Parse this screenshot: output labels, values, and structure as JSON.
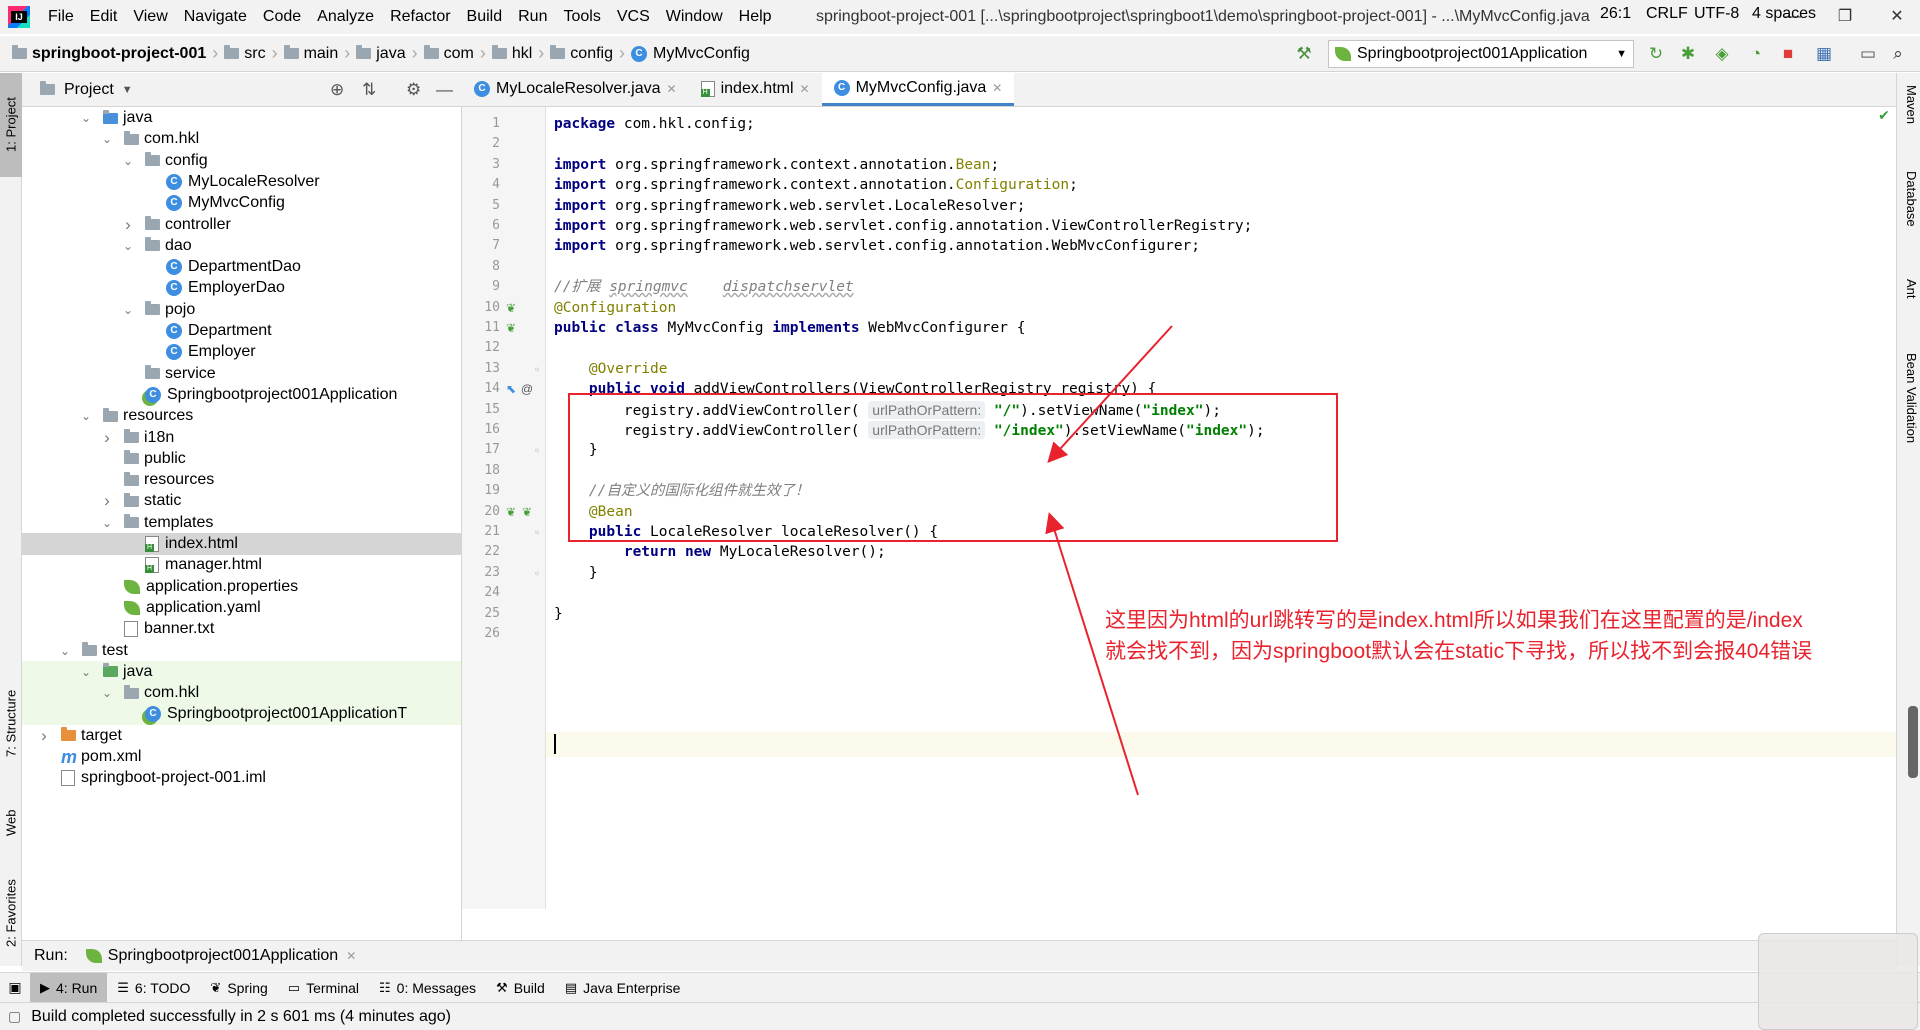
{
  "window": {
    "title": "springboot-project-001 [...\\springbootproject\\springboot1\\demo\\springboot-project-001] - ...\\MyMvcConfig.java",
    "minimize": "—",
    "restore": "❐",
    "close": "✕"
  },
  "menu": [
    "File",
    "Edit",
    "View",
    "Navigate",
    "Code",
    "Analyze",
    "Refactor",
    "Build",
    "Run",
    "Tools",
    "VCS",
    "Window",
    "Help"
  ],
  "breadcrumbs": [
    "springboot-project-001",
    "src",
    "main",
    "java",
    "com",
    "hkl",
    "config",
    "MyMvcConfig"
  ],
  "run_config": {
    "label": "Springbootproject001Application"
  },
  "icons": {
    "hammer": "hammer-icon",
    "rerun": "rerun-icon",
    "debug": "debug-icon",
    "coverage": "coverage-icon",
    "profile": "profile-icon",
    "stop": "stop-icon",
    "structure": "project-structure-icon",
    "layout": "layout-icon",
    "search": "search-icon"
  },
  "left_strip": {
    "project": "1: Project",
    "structure": "7: Structure",
    "web": "Web",
    "favorites": "2: Favorites"
  },
  "right_strip": {
    "maven": "Maven",
    "database": "Database",
    "ant": "Ant",
    "bean_validation": "Bean Validation"
  },
  "project_panel": {
    "title": "Project"
  },
  "tree": [
    {
      "label": "java",
      "depth": 3,
      "type": "folder-src",
      "arrow": "open"
    },
    {
      "label": "com.hkl",
      "depth": 4,
      "type": "package",
      "arrow": "open"
    },
    {
      "label": "config",
      "depth": 5,
      "type": "package",
      "arrow": "open"
    },
    {
      "label": "MyLocaleResolver",
      "depth": 6,
      "type": "class",
      "arrow": ""
    },
    {
      "label": "MyMvcConfig",
      "depth": 6,
      "type": "class",
      "arrow": ""
    },
    {
      "label": "controller",
      "depth": 5,
      "type": "package",
      "arrow": "closed"
    },
    {
      "label": "dao",
      "depth": 5,
      "type": "package",
      "arrow": "open"
    },
    {
      "label": "DepartmentDao",
      "depth": 6,
      "type": "class",
      "arrow": ""
    },
    {
      "label": "EmployerDao",
      "depth": 6,
      "type": "class",
      "arrow": ""
    },
    {
      "label": "pojo",
      "depth": 5,
      "type": "package",
      "arrow": "open"
    },
    {
      "label": "Department",
      "depth": 6,
      "type": "class",
      "arrow": ""
    },
    {
      "label": "Employer",
      "depth": 6,
      "type": "class",
      "arrow": ""
    },
    {
      "label": "service",
      "depth": 5,
      "type": "package",
      "arrow": ""
    },
    {
      "label": "Springbootproject001Application",
      "depth": 5,
      "type": "spring-class",
      "arrow": ""
    },
    {
      "label": "resources",
      "depth": 3,
      "type": "folder",
      "arrow": "open"
    },
    {
      "label": "i18n",
      "depth": 4,
      "type": "folder",
      "arrow": "closed"
    },
    {
      "label": "public",
      "depth": 4,
      "type": "folder",
      "arrow": ""
    },
    {
      "label": "resources",
      "depth": 4,
      "type": "folder",
      "arrow": ""
    },
    {
      "label": "static",
      "depth": 4,
      "type": "folder",
      "arrow": "closed"
    },
    {
      "label": "templates",
      "depth": 4,
      "type": "folder",
      "arrow": "open"
    },
    {
      "label": "index.html",
      "depth": 5,
      "type": "html",
      "arrow": "",
      "selected": true
    },
    {
      "label": "manager.html",
      "depth": 5,
      "type": "html",
      "arrow": ""
    },
    {
      "label": "application.properties",
      "depth": 4,
      "type": "properties",
      "arrow": ""
    },
    {
      "label": "application.yaml",
      "depth": 4,
      "type": "properties",
      "arrow": ""
    },
    {
      "label": "banner.txt",
      "depth": 4,
      "type": "text",
      "arrow": ""
    },
    {
      "label": "test",
      "depth": 2,
      "type": "folder",
      "arrow": "open"
    },
    {
      "label": "java",
      "depth": 3,
      "type": "folder-test",
      "arrow": "open",
      "test": true
    },
    {
      "label": "com.hkl",
      "depth": 4,
      "type": "package",
      "arrow": "open",
      "test": true
    },
    {
      "label": "Springbootproject001ApplicationT",
      "depth": 5,
      "type": "spring-class",
      "arrow": "",
      "test": true
    },
    {
      "label": "target",
      "depth": 1,
      "type": "folder-orange",
      "arrow": "closed"
    },
    {
      "label": "pom.xml",
      "depth": 1,
      "type": "maven",
      "arrow": ""
    },
    {
      "label": "springboot-project-001.iml",
      "depth": 1,
      "type": "text",
      "arrow": ""
    }
  ],
  "editor_tabs": [
    {
      "label": "MyLocaleResolver.java",
      "icon": "class",
      "active": false
    },
    {
      "label": "index.html",
      "icon": "html",
      "active": false
    },
    {
      "label": "MyMvcConfig.java",
      "icon": "class",
      "active": true
    }
  ],
  "code_lines": [
    [
      {
        "t": "kw",
        "v": "package"
      },
      {
        "t": "",
        "v": " com.hkl.config;"
      }
    ],
    [],
    [
      {
        "t": "kw",
        "v": "import"
      },
      {
        "t": "",
        "v": " org.springframework.context.annotation."
      },
      {
        "t": "ann",
        "v": "Bean"
      },
      {
        "t": "",
        "v": ";"
      }
    ],
    [
      {
        "t": "kw",
        "v": "import"
      },
      {
        "t": "",
        "v": " org.springframework.context.annotation."
      },
      {
        "t": "ann",
        "v": "Configuration"
      },
      {
        "t": "",
        "v": ";"
      }
    ],
    [
      {
        "t": "kw",
        "v": "import"
      },
      {
        "t": "",
        "v": " org.springframework.web.servlet.LocaleResolver;"
      }
    ],
    [
      {
        "t": "kw",
        "v": "import"
      },
      {
        "t": "",
        "v": " org.springframework.web.servlet.config.annotation.ViewControllerRegistry;"
      }
    ],
    [
      {
        "t": "kw",
        "v": "import"
      },
      {
        "t": "",
        "v": " org.springframework.web.servlet.config.annotation.WebMvcConfigurer;"
      }
    ],
    [],
    [
      {
        "t": "cmt",
        "v": "//扩展 "
      },
      {
        "t": "cmt uline",
        "v": "springmvc"
      },
      {
        "t": "cmt",
        "v": "    "
      },
      {
        "t": "cmt uline",
        "v": "dispatchservlet"
      }
    ],
    [
      {
        "t": "ann",
        "v": "@Configuration"
      }
    ],
    [
      {
        "t": "kw",
        "v": "public class"
      },
      {
        "t": "",
        "v": " MyMvcConfig "
      },
      {
        "t": "kw",
        "v": "implements"
      },
      {
        "t": "",
        "v": " WebMvcConfigurer {"
      }
    ],
    [],
    [
      {
        "t": "",
        "v": "    "
      },
      {
        "t": "ann",
        "v": "@Override"
      }
    ],
    [
      {
        "t": "",
        "v": "    "
      },
      {
        "t": "kw",
        "v": "public void"
      },
      {
        "t": "",
        "v": " addViewControllers(ViewControllerRegistry registry) {"
      }
    ],
    [
      {
        "t": "",
        "v": "        registry.addViewController( "
      },
      {
        "t": "hint",
        "v": "urlPathOrPattern:"
      },
      {
        "t": "",
        "v": " "
      },
      {
        "t": "str",
        "v": "\"/\""
      },
      {
        "t": "",
        "v": ").setViewName("
      },
      {
        "t": "str",
        "v": "\"index\""
      },
      {
        "t": "",
        "v": ");"
      }
    ],
    [
      {
        "t": "",
        "v": "        registry.addViewController( "
      },
      {
        "t": "hint",
        "v": "urlPathOrPattern:"
      },
      {
        "t": "",
        "v": " "
      },
      {
        "t": "str",
        "v": "\"/index\""
      },
      {
        "t": "",
        "v": ").setViewName("
      },
      {
        "t": "str",
        "v": "\"index\""
      },
      {
        "t": "",
        "v": ");"
      }
    ],
    [
      {
        "t": "",
        "v": "    }"
      }
    ],
    [],
    [
      {
        "t": "",
        "v": "    "
      },
      {
        "t": "cmt",
        "v": "//自定义的国际化组件就生效了！"
      }
    ],
    [
      {
        "t": "",
        "v": "    "
      },
      {
        "t": "ann",
        "v": "@Bean"
      }
    ],
    [
      {
        "t": "",
        "v": "    "
      },
      {
        "t": "kw",
        "v": "public"
      },
      {
        "t": "",
        "v": " LocaleResolver localeResolver() {"
      }
    ],
    [
      {
        "t": "",
        "v": "        "
      },
      {
        "t": "kw",
        "v": "return new"
      },
      {
        "t": "",
        "v": " MyLocaleResolver();"
      }
    ],
    [
      {
        "t": "",
        "v": "    }"
      }
    ],
    [],
    [
      {
        "t": "",
        "v": "}"
      }
    ],
    []
  ],
  "annotation": {
    "line1": "这里因为html的url跳转写的是index.html所以如果我们在这里配置的是/index",
    "line2": "就会找不到，因为springboot默认会在static下寻找，所以找不到会报404错误"
  },
  "run_bar": {
    "label": "Run:",
    "config": "Springbootproject001Application"
  },
  "tool_windows": [
    {
      "label": "4: Run",
      "icon": "run-icon",
      "active": true
    },
    {
      "label": "6: TODO",
      "icon": "todo-icon",
      "active": false
    },
    {
      "label": "Spring",
      "icon": "spring-icon",
      "active": false
    },
    {
      "label": "Terminal",
      "icon": "terminal-icon",
      "active": false
    },
    {
      "label": "0: Messages",
      "icon": "messages-icon",
      "active": false
    },
    {
      "label": "Build",
      "icon": "build-icon",
      "active": false
    },
    {
      "label": "Java Enterprise",
      "icon": "java-enterprise-icon",
      "active": false
    }
  ],
  "status": {
    "message": "Build completed successfully in 2 s 601 ms (4 minutes ago)",
    "position": "26:1",
    "line_sep": "CRLF",
    "encoding": "UTF-8",
    "indent": "4 spaces"
  },
  "colors": {
    "accent": "#4083c9",
    "annotation_red": "#e8232e"
  }
}
